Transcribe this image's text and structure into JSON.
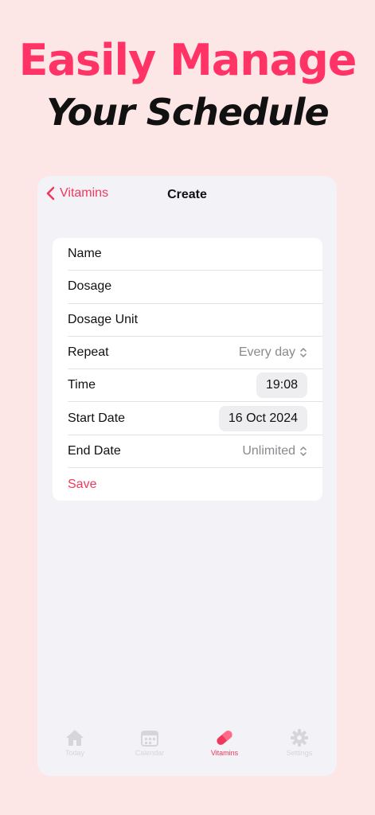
{
  "promo": {
    "headline": "Easily Manage",
    "subline": "Your Schedule"
  },
  "nav": {
    "back_label": "Vitamins",
    "title": "Create"
  },
  "form": {
    "name_label": "Name",
    "dosage_label": "Dosage",
    "dosage_unit_label": "Dosage Unit",
    "repeat_label": "Repeat",
    "repeat_value": "Every day",
    "time_label": "Time",
    "time_value": "19:08",
    "start_date_label": "Start Date",
    "start_date_value": "16 Oct 2024",
    "end_date_label": "End Date",
    "end_date_value": "Unlimited",
    "save_label": "Save"
  },
  "tabbar": {
    "items": [
      {
        "label": "Today",
        "icon": "house-icon",
        "active": false
      },
      {
        "label": "Calendar",
        "icon": "calendar-icon",
        "active": false
      },
      {
        "label": "Vitamins",
        "icon": "pill-icon",
        "active": true
      },
      {
        "label": "Settings",
        "icon": "gear-icon",
        "active": false
      }
    ]
  },
  "colors": {
    "accent": "#f0385c",
    "background": "#fde6e6",
    "headline": "#ff3366"
  }
}
